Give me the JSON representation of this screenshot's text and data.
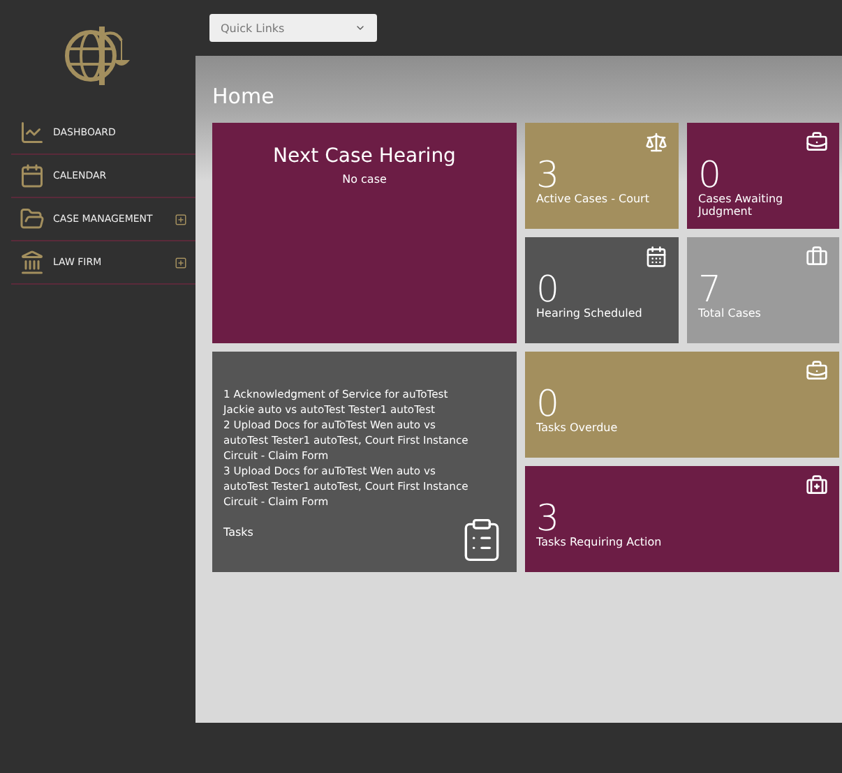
{
  "quick_links": {
    "label": "Quick Links"
  },
  "sidebar": {
    "items": [
      {
        "label": "DASHBOARD",
        "expandable": false
      },
      {
        "label": "CALENDAR",
        "expandable": false
      },
      {
        "label": "CASE MANAGEMENT",
        "expandable": true
      },
      {
        "label": "LAW FIRM",
        "expandable": true
      }
    ]
  },
  "page_title": "Home",
  "next_hearing": {
    "title": "Next Case Hearing",
    "value": "No case"
  },
  "stat_tiles": [
    {
      "count": "3",
      "label": "Active Cases - Court",
      "color": "#a38f5e"
    },
    {
      "count": "0",
      "label": "Cases Awaiting Judgment",
      "color": "#6c1d45"
    },
    {
      "count": "0",
      "label": "Hearing Scheduled",
      "color": "#545454"
    },
    {
      "count": "7",
      "label": "Total Cases",
      "color": "#9b9b9b"
    }
  ],
  "tasks": {
    "items": [
      "1 Acknowledgment of Service for auToTest Jackie auto vs autoTest Tester1 autoTest",
      "2 Upload Docs for auToTest Wen auto vs autoTest Tester1 autoTest, Court First Instance Circuit - Claim Form",
      "3 Upload Docs for auToTest Wen auto vs autoTest Tester1 autoTest, Court First Instance Circuit - Claim Form"
    ],
    "label": "Tasks"
  },
  "task_tiles": [
    {
      "count": "0",
      "label": "Tasks Overdue",
      "color": "#a38f5e"
    },
    {
      "count": "3",
      "label": "Tasks Requiring Action",
      "color": "#6c1d45"
    }
  ]
}
